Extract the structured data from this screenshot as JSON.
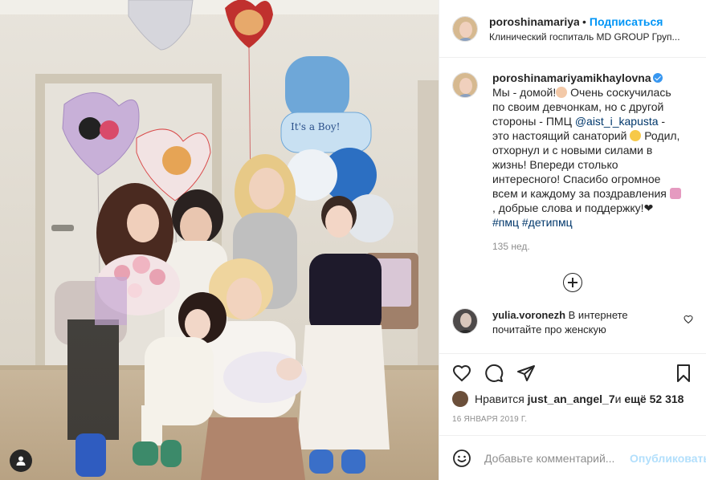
{
  "post": {
    "author": "poroshinamariyamikhaylovna",
    "author_short": "poroshinamariyar",
    "follow_label": "Подписаться",
    "location": "Клинический госпиталь MD GROUP Груп...",
    "caption": {
      "username": "poroshinamariyamikhaylovna",
      "text_1": " Мы - домой!",
      "text_2": " Очень соскучилась по своим девчонкам, но с другой стороны - ПМЦ ",
      "mention": "@aist_i_kapusta",
      "text_3": " - это настоящий санаторий",
      "text_4": " Родил, отхорнул и с новыми силами в жизнь! Впереди столько интересного! Спасибо огромное всем и каждому за поздравления",
      "text_5": " , добрые слова и поддержку!",
      "text_6": "❤",
      "hashtags": "#пмц #детипмц",
      "time_ago": "135 нед."
    },
    "comment": {
      "username": "yulia.voronezh",
      "text": " В интернете почитайте про женскую"
    },
    "likes": {
      "prefix": "Нравится ",
      "user": "just_an_angel_7",
      "middle": " и ",
      "count": "ещё 52 318"
    },
    "date": "16 ЯНВАРЯ 2019 Г.",
    "add_comment_placeholder": "Добавьте комментарий...",
    "publish_label": "Опубликовать"
  },
  "photo": {
    "balloon_text": "It's a Boy!"
  },
  "colors": {
    "accent": "#0095f6",
    "link": "#00376b",
    "muted": "#8e8e8e",
    "publish_disabled": "#b2dffc"
  }
}
